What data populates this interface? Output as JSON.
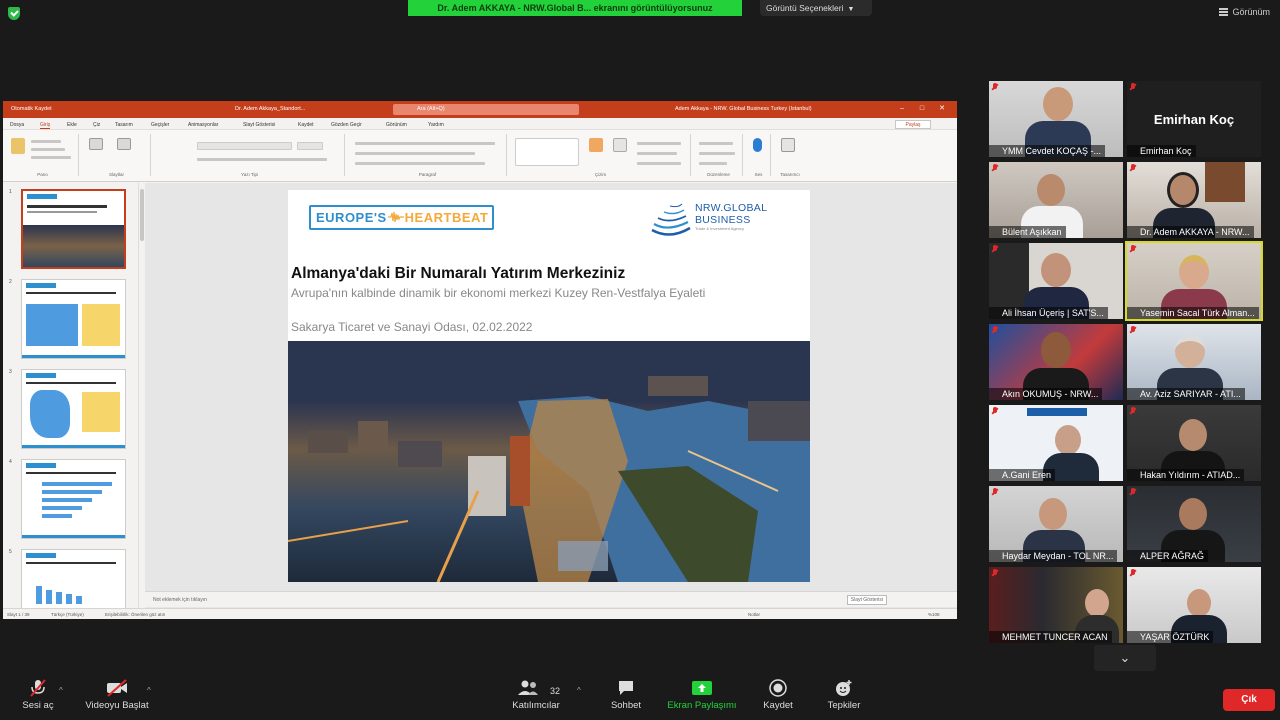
{
  "meeting": {
    "share_banner": "Dr. Adem AKKAYA - NRW.Global B... ekranını görüntülüyorsunuz",
    "view_options": "Görüntü Seçenekleri",
    "view_toggle": "Görünüm",
    "security_icon": "shield-check-icon"
  },
  "powerpoint": {
    "autosave": "Otomatik Kaydet",
    "filename": "Dr. Adem Akkaya_Standort...",
    "search": "Ara (Alt+Q)",
    "user": "Adem Akkaya - NRW. Global Business Turkey (Istanbul)",
    "share_label": "Paylaş",
    "menu": [
      "Dosya",
      "Giriş",
      "Ekle",
      "Çiz",
      "Tasarım",
      "Geçişler",
      "Animasyonlar",
      "Slayt Gösterisi",
      "Kaydet",
      "Gözden Geçir",
      "Görünüm",
      "Yardım"
    ],
    "ribbon_groups": [
      "Pano",
      "Slaytlar",
      "Yazı Tipi",
      "Paragraf",
      "Çizim",
      "Düzenleme",
      "Ses",
      "Tasarımcı"
    ],
    "notes_placeholder": "Not eklemek için tıklayın",
    "slide_show_btn": "Slayt Gösterisi",
    "status_slide": "Slayt 1 / 39",
    "status_lang": "Türkçe (Türkiye)",
    "status_access": "Erişilebilirlik: Önerilen göz atın",
    "status_notes": "Notlar",
    "status_zoom": "%108",
    "slide_numbers": [
      "1",
      "2",
      "3",
      "4",
      "5"
    ]
  },
  "slide": {
    "logo_left_a": "EUROPE'S",
    "logo_left_b": "HEARTBEAT",
    "logo_right_a": "NRW.GLOBAL",
    "logo_right_b": "BUSINESS",
    "logo_right_c": "Trade & Investment Agency",
    "title": "Almanya'daki Bir Numaralı Yatırım Merkeziniz",
    "subtitle": "Avrupa'nın kalbinde dinamik bir ekonomi merkezi Kuzey Ren-Vestfalya Eyaleti",
    "date_line": "Sakarya Ticaret ve Sanayi Odası, 02.02.2022"
  },
  "participants": [
    {
      "name": "YMM Cevdet KOÇAŞ -...",
      "video": true
    },
    {
      "name": "Emirhan Koç",
      "video": false,
      "display": "Emirhan Koç"
    },
    {
      "name": "Bülent Aşıkkan",
      "video": true
    },
    {
      "name": "Dr. Adem AKKAYA - NRW...",
      "video": true
    },
    {
      "name": "Ali İhsan Üçeriş | SAT'S...",
      "video": true
    },
    {
      "name": "Yasemin Sacal Türk Alman...",
      "video": true,
      "active": true
    },
    {
      "name": "Akın OKUMUŞ - NRW...",
      "video": true
    },
    {
      "name": "Av. Aziz SARIYAR - ATI...",
      "video": true
    },
    {
      "name": "A.Gani Eren",
      "video": true
    },
    {
      "name": "Hakan Yıldırım - ATIAD...",
      "video": true
    },
    {
      "name": "Haydar Meydan - TOL NR...",
      "video": true
    },
    {
      "name": "ALPER AĞRAĞ",
      "video": true
    },
    {
      "name": "MEHMET TUNCER ACAN",
      "video": true
    },
    {
      "name": "YAŞAR ÖZTÜRK",
      "video": true
    }
  ],
  "toolbar": {
    "mute": "Sesi aç",
    "video": "Videoyu Başlat",
    "participants": "Katılımcılar",
    "participant_count": "32",
    "chat": "Sohbet",
    "share": "Ekran Paylaşımı",
    "record": "Kaydet",
    "reactions": "Tepkiler",
    "end": "Çık"
  },
  "colors": {
    "accent_green": "#23d23a",
    "ppt_red": "#c43e1c",
    "end_red": "#e02828",
    "active_speaker": "#d6d92a"
  }
}
